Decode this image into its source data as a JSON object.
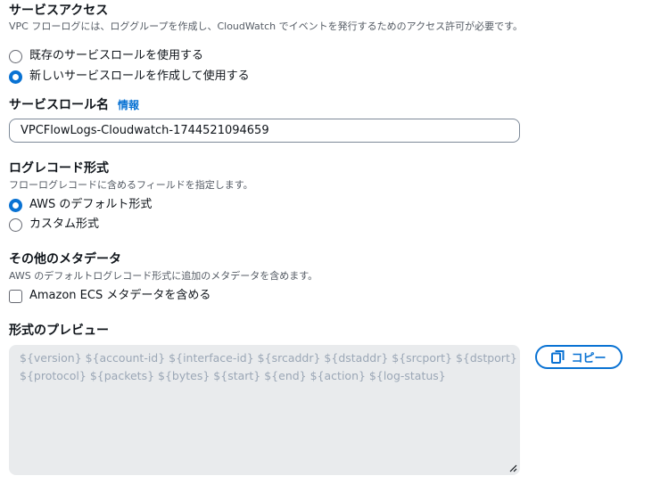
{
  "service_access": {
    "title": "サービスアクセス",
    "description": "VPC フローログには、ロググループを作成し、CloudWatch でイベントを発行するためのアクセス許可が必要です。",
    "options": [
      {
        "label": "既存のサービスロールを使用する",
        "selected": false
      },
      {
        "label": "新しいサービスロールを作成して使用する",
        "selected": true
      }
    ]
  },
  "service_role_name": {
    "label": "サービスロール名",
    "info_link": "情報",
    "value": "VPCFlowLogs-Cloudwatch-1744521094659"
  },
  "log_record_format": {
    "title": "ログレコード形式",
    "description": "フローログレコードに含めるフィールドを指定します。",
    "options": [
      {
        "label": "AWS のデフォルト形式",
        "selected": true
      },
      {
        "label": "カスタム形式",
        "selected": false
      }
    ]
  },
  "other_metadata": {
    "title": "その他のメタデータ",
    "description": "AWS のデフォルトログレコード形式に追加のメタデータを含めます。",
    "checkbox_label": "Amazon ECS メタデータを含める",
    "checked": false
  },
  "format_preview": {
    "title": "形式のプレビュー",
    "lines": [
      "${version} ${account-id} ${interface-id} ${srcaddr} ${dstaddr} ${srcport} ${dstport}",
      "${protocol} ${packets} ${bytes} ${start} ${end} ${action} ${log-status}"
    ],
    "copy_label": "コピー"
  },
  "colors": {
    "accent": "#0972d3",
    "text": "#0f141a",
    "secondary_text": "#545b64",
    "preview_bg": "#e9ebed",
    "preview_text": "#9ba7b6"
  }
}
